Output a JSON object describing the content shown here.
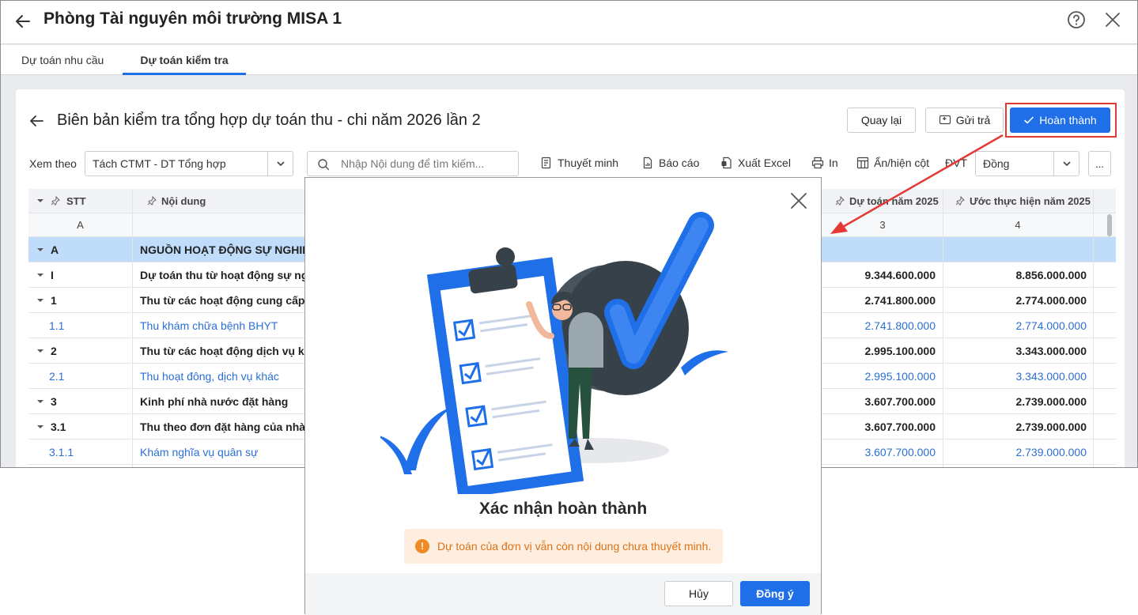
{
  "window": {
    "title": "Phòng Tài nguyên môi trường MISA 1"
  },
  "tabs": [
    {
      "label": "Dự toán nhu cầu"
    },
    {
      "label": "Dự toán kiểm tra"
    }
  ],
  "panel": {
    "title": "Biên bản kiểm tra tổng hợp dự toán thu - chi năm 2026 lần 2",
    "buttons": {
      "back": "Quay lại",
      "send_back": "Gửi trả",
      "complete": "Hoàn thành"
    }
  },
  "toolbar": {
    "view_by_label": "Xem theo",
    "view_by_value": "Tách CTMT - DT Tổng hợp",
    "search_placeholder": "Nhập Nội dung để tìm kiếm...",
    "explain": "Thuyết minh",
    "report": "Báo cáo",
    "export_excel": "Xuất Excel",
    "print": "In",
    "toggle_columns": "Ẩn/hiện cột",
    "unit_label": "ĐVT",
    "unit_value": "Đồng",
    "more": "..."
  },
  "grid": {
    "columns": [
      {
        "label": "STT",
        "code": "A"
      },
      {
        "label": "Nội dung",
        "code": ""
      },
      {
        "label": "Dự toán năm 2025",
        "code": "3"
      },
      {
        "label": "Ước thực hiện năm 2025",
        "code": "4"
      }
    ],
    "rows": [
      {
        "stt": "A",
        "content": "NGUỒN HOẠT ĐỘNG SỰ NGHIỆP",
        "c3": "",
        "c4": "",
        "style": "sel",
        "caret": true
      },
      {
        "stt": "I",
        "content": "Dự toán thu từ hoạt động sự nghi",
        "c3": "9.344.600.000",
        "c4": "8.856.000.000",
        "style": "bold",
        "caret": true
      },
      {
        "stt": "1",
        "content": "Thu từ các hoạt động cung cấp c",
        "c3": "2.741.800.000",
        "c4": "2.774.000.000",
        "style": "bold",
        "caret": true
      },
      {
        "stt": "1.1",
        "content": "Thu khám chữa bệnh BHYT",
        "c3": "2.741.800.000",
        "c4": "2.774.000.000",
        "style": "link",
        "caret": false
      },
      {
        "stt": "2",
        "content": "Thu từ các hoạt động dịch vụ khá",
        "c3": "2.995.100.000",
        "c4": "3.343.000.000",
        "style": "bold",
        "caret": true
      },
      {
        "stt": "2.1",
        "content": "Thu hoạt đông, dịch vụ khác",
        "c3": "2.995.100.000",
        "c4": "3.343.000.000",
        "style": "link",
        "caret": false
      },
      {
        "stt": "3",
        "content": "Kinh phí nhà nước đặt hàng",
        "c3": "3.607.700.000",
        "c4": "2.739.000.000",
        "style": "bold",
        "caret": true
      },
      {
        "stt": "3.1",
        "content": "Thu theo đơn đặt hàng của nhà n",
        "c3": "3.607.700.000",
        "c4": "2.739.000.000",
        "style": "bold",
        "caret": true
      },
      {
        "stt": "3.1.1",
        "content": "Khám nghĩa vụ quân sự",
        "c3": "3.607.700.000",
        "c4": "2.739.000.000",
        "style": "link",
        "caret": false
      }
    ]
  },
  "modal": {
    "title": "Xác nhận hoàn thành",
    "warning": "Dự toán của đơn vị vẫn còn nội dung chưa thuyết minh.",
    "cancel": "Hủy",
    "ok": "Đồng ý"
  },
  "colors": {
    "primary": "#1e6fe8",
    "highlight": "#e53935",
    "warning": "#f08a24",
    "selected_row": "#bfdcfb"
  }
}
